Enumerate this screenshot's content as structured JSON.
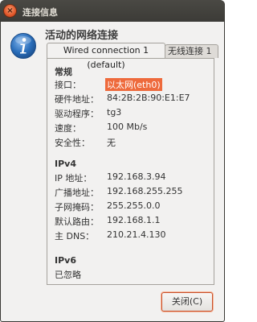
{
  "window": {
    "title": "连接信息"
  },
  "heading": "活动的网络连接",
  "tabs": [
    {
      "label": "Wired connection 1 (default)"
    },
    {
      "label": "无线连接 1"
    }
  ],
  "general": {
    "section_title": "常规",
    "interface": {
      "label": "接口：",
      "value": "以太网(eth0)"
    },
    "hardware_address": {
      "label": "硬件地址：",
      "value": "84:2B:2B:90:E1:E7"
    },
    "driver": {
      "label": "驱动程序：",
      "value": "tg3"
    },
    "speed": {
      "label": "速度：",
      "value": "100 Mb/s"
    },
    "security": {
      "label": "安全性：",
      "value": "无"
    }
  },
  "ipv4": {
    "section_title": "IPv4",
    "ip_address": {
      "label": "IP 地址：",
      "value": "192.168.3.94"
    },
    "broadcast": {
      "label": "广播地址：",
      "value": "192.168.255.255"
    },
    "subnet_mask": {
      "label": "子网掩码：",
      "value": "255.255.0.0"
    },
    "default_route": {
      "label": "默认路由：",
      "value": "192.168.1.1"
    },
    "primary_dns": {
      "label": "主 DNS：",
      "value": "210.21.4.130"
    }
  },
  "ipv6": {
    "section_title": "IPv6",
    "status": "已忽略"
  },
  "buttons": {
    "close": "关闭(C)"
  },
  "icons": {
    "window_close": "close-icon",
    "info": "info-icon"
  },
  "colors": {
    "titlebar": "#3c3b37",
    "accent": "#ee6a3c",
    "info_blue": "#2a6ebb"
  }
}
